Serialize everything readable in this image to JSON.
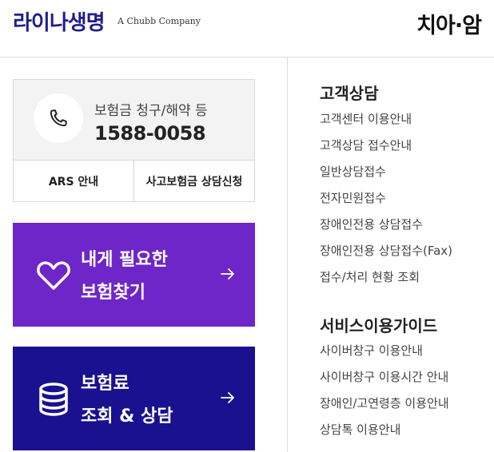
{
  "header": {
    "logo_text": "라이나생명",
    "logo_subtitle": "A Chubb Company",
    "page_name": "치아·암"
  },
  "call_card": {
    "label": "보험금 청구/해약 등",
    "number": "1588-0058",
    "ars_button": "ARS 안내",
    "accident_button": "사고보험금 상담신청"
  },
  "promos": [
    {
      "line1": "내게 필요한",
      "line2": "보험찾기",
      "icon": "heart-icon",
      "color": "#6e26c9"
    },
    {
      "line1": "보험료",
      "line2": "조회 & 상담",
      "icon": "coins-stack-icon",
      "color": "#19118f"
    }
  ],
  "customer_support": {
    "title": "고객상담",
    "links": [
      "고객센터 이용안내",
      "고객상담 접수안내",
      "일반상담접수",
      "전자민원접수",
      "장애인전용 상담접수",
      "장애인전용 상담접수(Fax)",
      "접수/처리 현황 조회"
    ]
  },
  "service_guide": {
    "title": "서비스이용가이드",
    "links": [
      "사이버창구 이용안내",
      "사이버창구 이용시간 안내",
      "장애인/고연령층 이용안내",
      "상담톡 이용안내"
    ]
  }
}
